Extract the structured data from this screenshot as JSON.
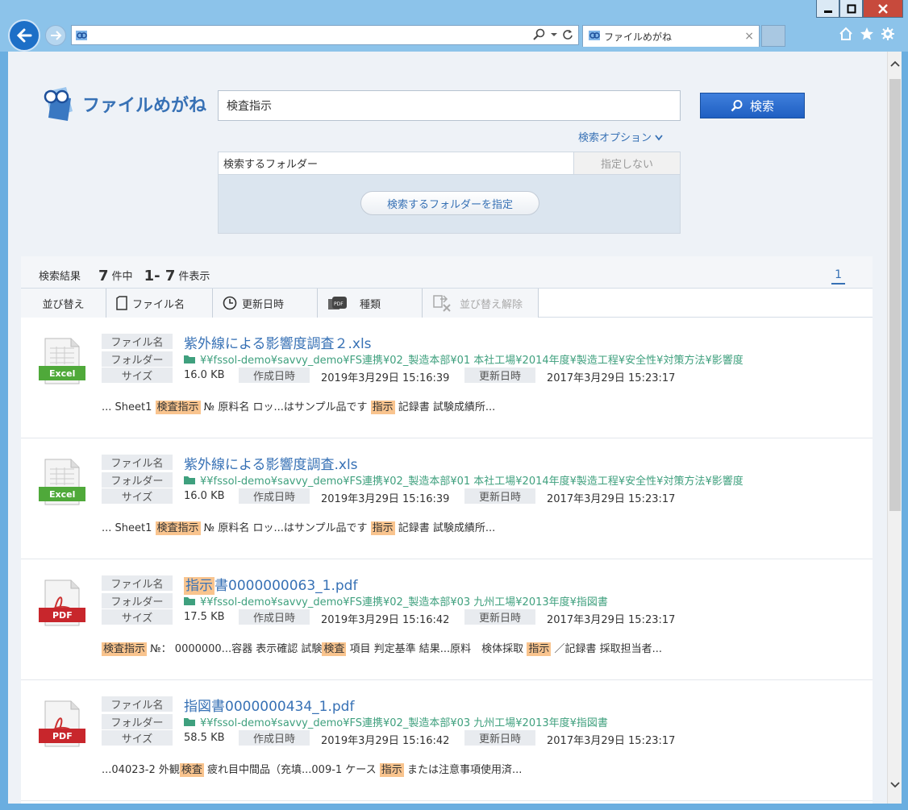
{
  "browser": {
    "tab_title": "ファイルめがね",
    "address": ""
  },
  "app": {
    "logo_text": "ファイルめがね",
    "search_value": "検査指示",
    "search_button": "検索",
    "search_option": "検索オプション",
    "folder_panel": {
      "label": "検索するフォルダー",
      "unspecified": "指定しない",
      "specify_button": "検索するフォルダーを指定"
    }
  },
  "summary": {
    "label": "検索結果",
    "total": "7",
    "total_unit": "件中",
    "range": "1- 7",
    "range_unit": "件表示",
    "page": "1"
  },
  "sort": {
    "label": "並び替え",
    "filename": "ファイル名",
    "updated": "更新日時",
    "type": "種類",
    "clear": "並び替え解除"
  },
  "labels": {
    "filename": "ファイル名",
    "folder": "フォルダー",
    "size": "サイズ",
    "created": "作成日時",
    "updated": "更新日時"
  },
  "results": [
    {
      "type": "Excel",
      "title_hl": "",
      "title_rest": "紫外線による影響度調査２.xls",
      "folder": "¥¥fssol-demo¥savvy_demo¥FS連携¥02_製造本部¥01 本社工場¥2014年度¥製造工程¥安全性¥対策方法¥影響度",
      "size": "16.0 KB",
      "created": "2019年3月29日 15:16:39",
      "updated": "2017年3月29日 15:23:17",
      "snippet": [
        {
          "t": "... Sheet1 ",
          "h": false
        },
        {
          "t": "検査指示",
          "h": true
        },
        {
          "t": " № 原料名 ロッ...はサンプル品です ",
          "h": false
        },
        {
          "t": "指示",
          "h": true
        },
        {
          "t": " 記録書 試験成績所...",
          "h": false
        }
      ]
    },
    {
      "type": "Excel",
      "title_hl": "",
      "title_rest": "紫外線による影響度調査.xls",
      "folder": "¥¥fssol-demo¥savvy_demo¥FS連携¥02_製造本部¥01 本社工場¥2014年度¥製造工程¥安全性¥対策方法¥影響度",
      "size": "16.0 KB",
      "created": "2019年3月29日 15:16:39",
      "updated": "2017年3月29日 15:23:17",
      "snippet": [
        {
          "t": "... Sheet1 ",
          "h": false
        },
        {
          "t": "検査指示",
          "h": true
        },
        {
          "t": " № 原料名 ロッ...はサンプル品です ",
          "h": false
        },
        {
          "t": "指示",
          "h": true
        },
        {
          "t": " 記録書 試験成績所...",
          "h": false
        }
      ]
    },
    {
      "type": "PDF",
      "title_hl": "指示",
      "title_rest": "書0000000063_1.pdf",
      "folder": "¥¥fssol-demo¥savvy_demo¥FS連携¥02_製造本部¥03 九州工場¥2013年度¥指図書",
      "size": "17.5 KB",
      "created": "2019年3月29日 15:16:42",
      "updated": "2017年3月29日 15:23:17",
      "snippet": [
        {
          "t": "検査指示",
          "h": true
        },
        {
          "t": " №： 0000000...容器 表示確認 試験",
          "h": false
        },
        {
          "t": "検査",
          "h": true
        },
        {
          "t": " 項目 判定基準 結果...原料　検体採取 ",
          "h": false
        },
        {
          "t": "指示",
          "h": true
        },
        {
          "t": " ／記録書 採取担当者...",
          "h": false
        }
      ]
    },
    {
      "type": "PDF",
      "title_hl": "",
      "title_rest": "指図書0000000434_1.pdf",
      "folder": "¥¥fssol-demo¥savvy_demo¥FS連携¥02_製造本部¥03 九州工場¥2013年度¥指図書",
      "size": "58.5 KB",
      "created": "2019年3月29日 15:16:42",
      "updated": "2017年3月29日 15:23:17",
      "snippet": [
        {
          "t": "...04023-2 外観",
          "h": false
        },
        {
          "t": "検査",
          "h": true
        },
        {
          "t": " 疲れ目中間品（充填...009-1 ケース ",
          "h": false
        },
        {
          "t": "指示",
          "h": true
        },
        {
          "t": " または注意事項使用済...",
          "h": false
        }
      ]
    }
  ]
}
